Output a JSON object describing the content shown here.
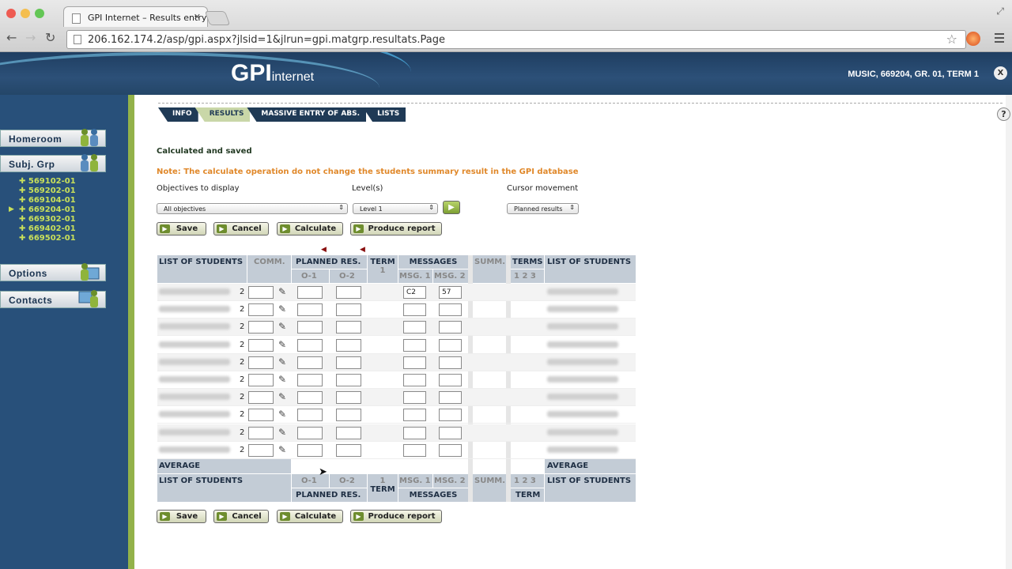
{
  "browser": {
    "tab_title": "GPI Internet – Results entry",
    "url": "206.162.174.2/asp/gpi.aspx?jlsid=1&jlrun=gpi.matgrp.resultats.Page"
  },
  "header": {
    "logo_main": "GPI",
    "logo_sub": "internet",
    "context": "MUSIC, 669204, GR. 01, TERM 1",
    "close_label": "X"
  },
  "sidebar": {
    "homeroom": "Homeroom",
    "subj_grp": "Subj. Grp",
    "groups": [
      "569102-01",
      "569202-01",
      "669104-01",
      "669204-01",
      "669302-01",
      "669402-01",
      "669502-01"
    ],
    "options": "Options",
    "contacts": "Contacts"
  },
  "tabs": [
    "INFO",
    "RESULTS",
    "MASSIVE ENTRY OF ABS.",
    "LISTS"
  ],
  "help_label": "?",
  "status_text": "Calculated and saved",
  "note_text": "Note: The calculate operation do not change the students summary result in the GPI database",
  "filters": {
    "objectives_label": "Objectives to display",
    "objectives_value": "All objectives",
    "levels_label": "Level(s)",
    "levels_value": "Level 1",
    "cursor_label": "Cursor movement",
    "cursor_value": "Planned results"
  },
  "buttons": {
    "save": "Save",
    "cancel": "Cancel",
    "calculate": "Calculate",
    "report": "Produce report"
  },
  "grid": {
    "list_of_students": "LIST OF STUDENTS",
    "comm": "COMM.",
    "planned_res": "PLANNED RES.",
    "o1": "O-1",
    "o2": "O-2",
    "term": "TERM",
    "term_num": "1",
    "messages": "MESSAGES",
    "msg1": "MSG. 1",
    "msg2": "MSG. 2",
    "summ": "SUMM.",
    "terms": "TERMS",
    "t1": "1",
    "t2": "2",
    "t3": "3",
    "average": "AVERAGE",
    "rows": [
      {
        "count": "2",
        "msg1": "C2",
        "msg2": "57"
      },
      {
        "count": "2",
        "msg1": "",
        "msg2": ""
      },
      {
        "count": "2",
        "msg1": "",
        "msg2": ""
      },
      {
        "count": "2",
        "msg1": "",
        "msg2": ""
      },
      {
        "count": "2",
        "msg1": "",
        "msg2": ""
      },
      {
        "count": "2",
        "msg1": "",
        "msg2": ""
      },
      {
        "count": "2",
        "msg1": "",
        "msg2": ""
      },
      {
        "count": "2",
        "msg1": "",
        "msg2": ""
      },
      {
        "count": "2",
        "msg1": "",
        "msg2": ""
      },
      {
        "count": "2",
        "msg1": "",
        "msg2": ""
      }
    ]
  }
}
